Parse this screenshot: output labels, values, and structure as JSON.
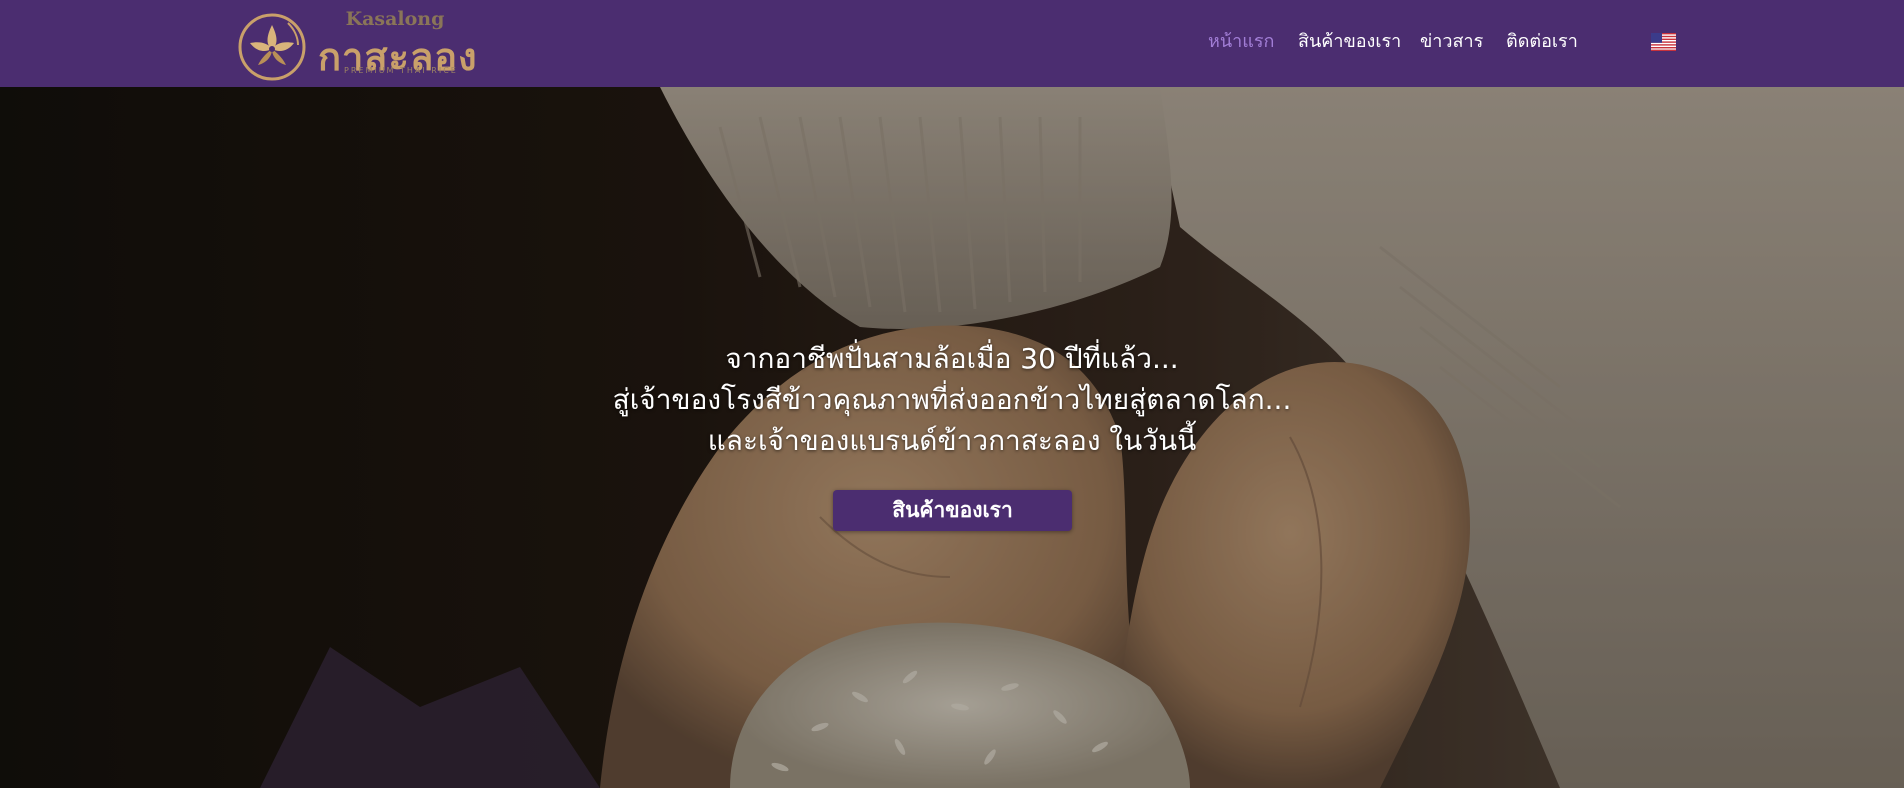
{
  "brand": {
    "name_latin": "Kasalong",
    "name_thai": "กาสะลอง",
    "tagline": "PREMIUM THAI RICE"
  },
  "nav": {
    "items": [
      {
        "label": "หน้าแรก",
        "active": true
      },
      {
        "label": "สินค้าของเรา",
        "active": false
      },
      {
        "label": "ข่าวสาร",
        "active": false
      },
      {
        "label": "ติดต่อเรา",
        "active": false
      }
    ],
    "language_icon": "us-flag-icon"
  },
  "hero": {
    "lines": [
      "จากอาชีพปั่นสามล้อเมื่อ 30 ปีที่แล้ว...",
      "สู่เจ้าของโรงสีข้าวคุณภาพที่ส่งออกข้าวไทยสู่ตลาดโลก...",
      "และเจ้าของแบรนด์ข้าวกาสะลอง ในวันนี้"
    ],
    "button_label": "สินค้าของเรา"
  },
  "colors": {
    "header_bg": "#4b2d70",
    "nav_active": "#a27ed6",
    "logo_gold": "#c9a06a",
    "button_bg": "#4b2d70"
  }
}
